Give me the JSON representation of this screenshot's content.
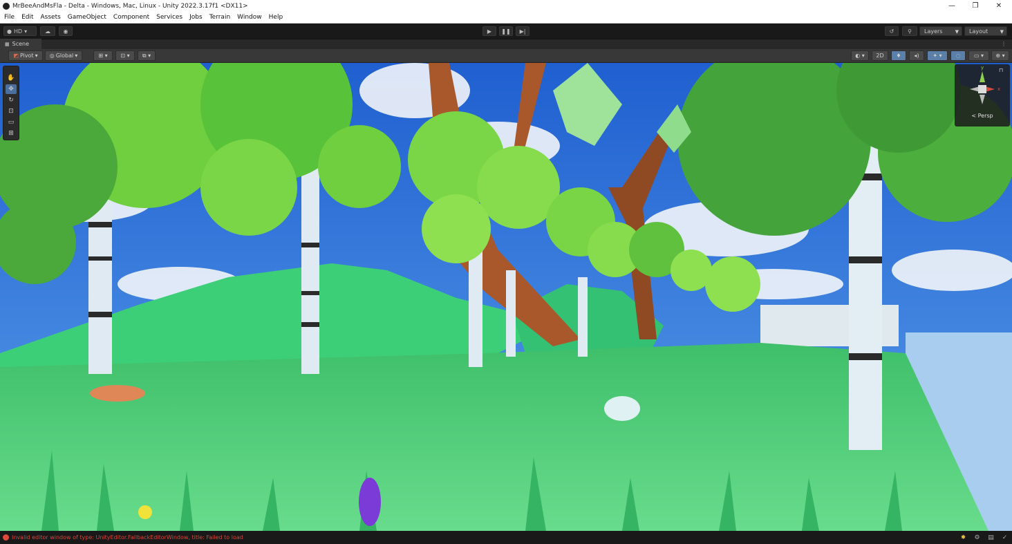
{
  "window": {
    "title": "MrBeeAndMsFla - Delta - Windows, Mac, Linux - Unity 2022.3.17f1 <DX11>",
    "minimize": "—",
    "maximize": "❐",
    "close": "✕"
  },
  "menu": [
    "File",
    "Edit",
    "Assets",
    "GameObject",
    "Component",
    "Services",
    "Jobs",
    "Terrain",
    "Window",
    "Help"
  ],
  "toolbar": {
    "account_label": "HD",
    "layers_label": "Layers",
    "layout_label": "Layout"
  },
  "scene_tab": {
    "label": "Scene"
  },
  "scene_toolbar": {
    "pivot_label": "Pivot",
    "global_label": "Global",
    "mode_2d_label": "2D"
  },
  "gizmo": {
    "x_label": "x",
    "y_label": "y",
    "persp_label": "< Persp"
  },
  "status": {
    "error_message": "Invalid editor window of type: UnityEditor.FallbackEditorWindow, title: Failed to load"
  },
  "colors": {
    "error": "#d9453a",
    "active_tool": "#4b6f9e",
    "sky": "#3a78d8",
    "grass": "#55d47e"
  }
}
